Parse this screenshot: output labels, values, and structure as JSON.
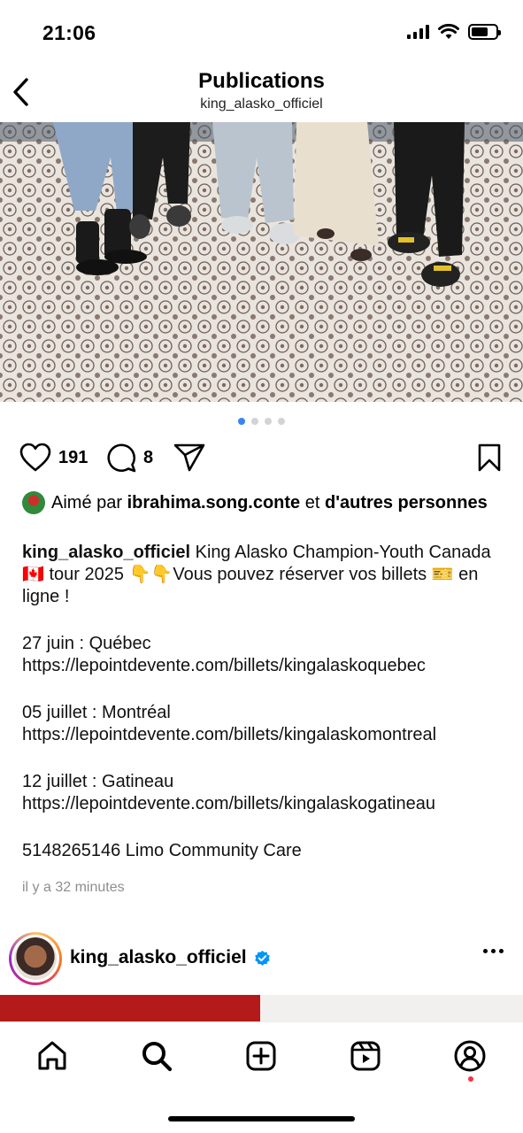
{
  "status_bar": {
    "time": "21:06"
  },
  "header": {
    "title": "Publications",
    "username": "king_alasko_officiel"
  },
  "carousel": {
    "count": 4,
    "active_index": 0
  },
  "actions": {
    "like_count": "191",
    "comment_count": "8"
  },
  "likes": {
    "prefix": "Aimé par",
    "liker": "ibrahima.song.conte",
    "conjunction": "et",
    "others": "d'autres personnes"
  },
  "caption": {
    "username": "king_alasko_officiel",
    "text": "King Alasko Champion-Youth Canada 🇨🇦 tour 2025 👇👇Vous pouvez réserver vos billets 🎫 en ligne !",
    "events": [
      {
        "date_city": "27 juin : Québec",
        "url": "https://lepointdevente.com/billets/kingalaskoquebec"
      },
      {
        "date_city": "05 juillet : Montréal",
        "url": "https://lepointdevente.com/billets/kingalaskomontreal"
      },
      {
        "date_city": "12 juillet : Gatineau",
        "url": "https://lepointdevente.com/billets/kingalaskogatineau"
      }
    ],
    "contact": "5148265146 Limo Community Care"
  },
  "timestamp": "il y a 32 minutes",
  "next_post": {
    "username": "king_alasko_officiel",
    "verified": true
  },
  "colors": {
    "accent_blue": "#3b82f6",
    "notification_red": "#ff3040",
    "verified_blue": "#0095f6"
  }
}
